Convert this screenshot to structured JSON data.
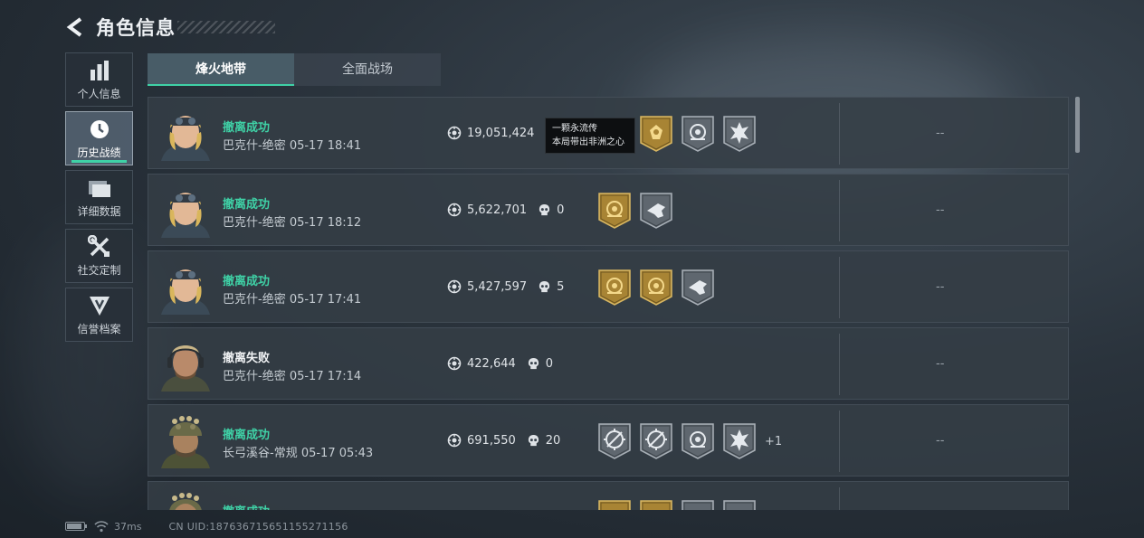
{
  "header": {
    "title": "角色信息"
  },
  "sidebar": {
    "items": [
      {
        "label": "个人信息",
        "icon": "bar-chart-icon",
        "active": false
      },
      {
        "label": "历史战绩",
        "icon": "clock-icon",
        "active": true
      },
      {
        "label": "详细数据",
        "icon": "folder-icon",
        "active": false
      },
      {
        "label": "社交定制",
        "icon": "tools-icon",
        "active": false
      },
      {
        "label": "信誉档案",
        "icon": "emblem-icon",
        "active": false
      }
    ]
  },
  "tabs": [
    {
      "label": "烽火地带",
      "active": true
    },
    {
      "label": "全面战场",
      "active": false
    }
  ],
  "rows": [
    {
      "status": "撤离成功",
      "status_type": "success",
      "subtitle": "巴克什-绝密 05-17 18:41",
      "value": "19,051,424",
      "kills": "",
      "badges": [
        "gold-heart-badge",
        "silver-eye-badge",
        "silver-burst-badge"
      ],
      "extra": "",
      "right": "--",
      "avatar": "blonde-goggles"
    },
    {
      "status": "撤离成功",
      "status_type": "success",
      "subtitle": "巴克什-绝密 05-17 18:12",
      "value": "5,622,701",
      "kills": "0",
      "badges": [
        "gold-eye-badge",
        "silver-gun-badge"
      ],
      "extra": "",
      "right": "--",
      "avatar": "blonde-goggles"
    },
    {
      "status": "撤离成功",
      "status_type": "success",
      "subtitle": "巴克什-绝密 05-17 17:41",
      "value": "5,427,597",
      "kills": "5",
      "badges": [
        "gold-eye-badge",
        "gold-eye-badge",
        "silver-gun-badge"
      ],
      "extra": "",
      "right": "--",
      "avatar": "blonde-goggles"
    },
    {
      "status": "撤离失败",
      "status_type": "fail",
      "subtitle": "巴克什-绝密 05-17 17:14",
      "value": "422,644",
      "kills": "0",
      "badges": [],
      "extra": "",
      "right": "--",
      "avatar": "bearded-headset"
    },
    {
      "status": "撤离成功",
      "status_type": "success",
      "subtitle": "长弓溪谷-常规 05-17 05:43",
      "value": "691,550",
      "kills": "20",
      "badges": [
        "silver-crosshair-badge",
        "silver-crosshair-badge",
        "silver-eye-badge",
        "silver-burst-badge"
      ],
      "extra": "+1",
      "right": "--",
      "avatar": "camo-helmet"
    },
    {
      "status": "撤离成功",
      "status_type": "success",
      "subtitle": "",
      "value": "",
      "kills": "",
      "badges": [
        "gold-eye-badge",
        "gold-eye-badge",
        "silver-eye-badge",
        "silver-eye-badge"
      ],
      "extra": "",
      "right": "",
      "avatar": "camo-helmet"
    }
  ],
  "tooltip": {
    "line1": "一颗永流传",
    "line2": "本局带出非洲之心"
  },
  "footer": {
    "ping": "37ms",
    "uid": "CN UID:187636715651155271156"
  },
  "colors": {
    "success": "#3fd1a6",
    "accent": "#3fd1a6",
    "gold_badge": "#b8903a",
    "silver_badge": "#6d757d"
  }
}
